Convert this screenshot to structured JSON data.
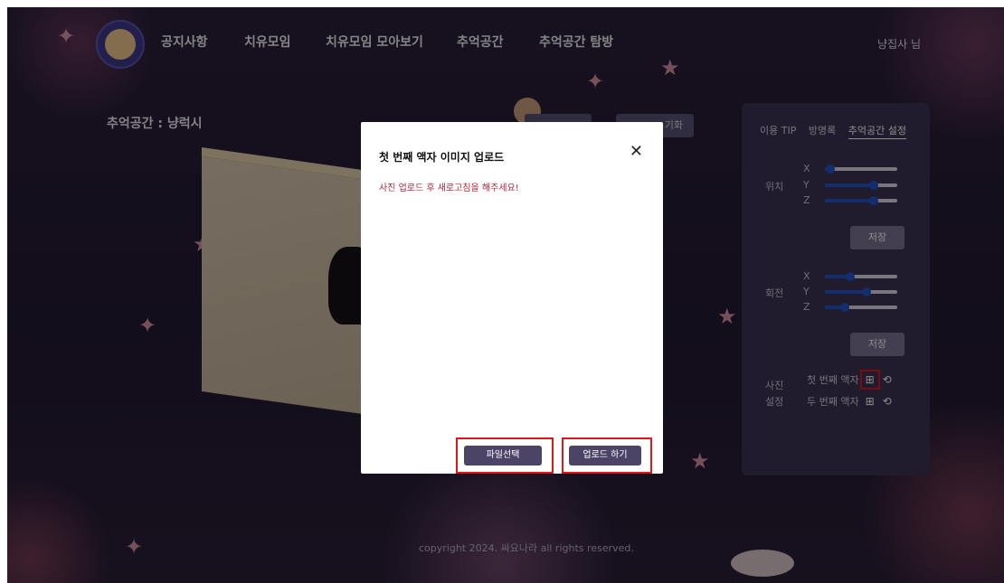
{
  "nav": {
    "items": [
      "공지사항",
      "치유모임",
      "치유모임 모아보기",
      "추억공간",
      "추억공간 탐방"
    ],
    "user": "냥집사 님"
  },
  "page": {
    "space_title": "추억공간 : 냥럭시",
    "top_buttons": [
      "",
      "기화"
    ]
  },
  "panel": {
    "tabs": [
      "이용 TIP",
      "방명록",
      "추억공간 설정"
    ],
    "position_label": "위치",
    "rotation_label": "회전",
    "axes": [
      "X",
      "Y",
      "Z"
    ],
    "position_values": [
      0.08,
      0.68,
      0.68
    ],
    "rotation_values": [
      0.35,
      0.58,
      0.28
    ],
    "save_label": "저장",
    "photo_label": [
      "사진",
      "설정"
    ],
    "frames": [
      "첫 번째 액자",
      "두 번째 액자"
    ]
  },
  "modal": {
    "title": "첫 번째 액자 이미지 업로드",
    "message": "사진 업로드 후 새로고침을 해주세요!",
    "file_button": "파일선택",
    "upload_button": "업로드 하기"
  },
  "footer": {
    "text": "copyright 2024. 싸요나라 all rights reserved."
  },
  "colors": {
    "highlight": "#e0161b",
    "button": "#4c4466",
    "panel": "#3b3452",
    "slider": "#2453c9"
  }
}
